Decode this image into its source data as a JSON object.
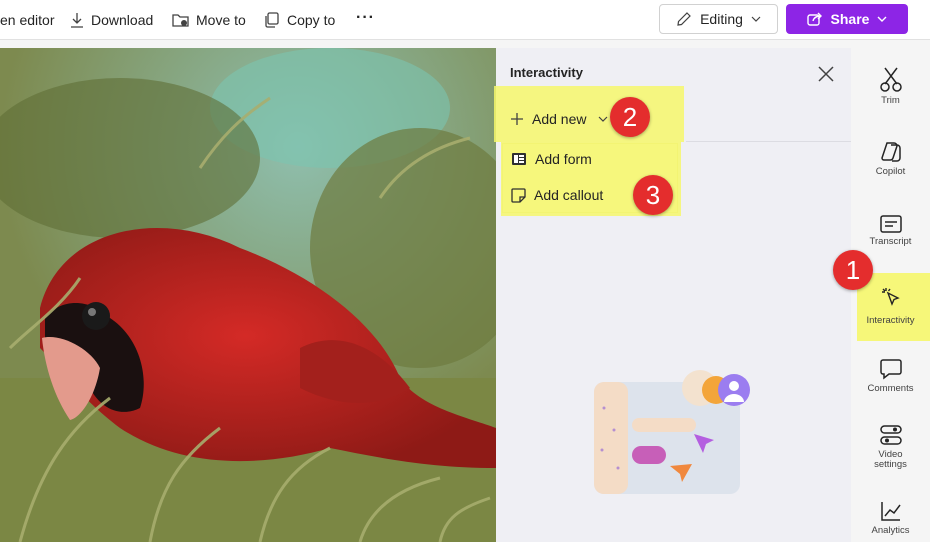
{
  "toolbar": {
    "open_editor_label": "en editor",
    "download_label": "Download",
    "move_to_label": "Move to",
    "copy_to_label": "Copy to",
    "more_label": "···",
    "editing_label": "Editing",
    "share_label": "Share"
  },
  "panel": {
    "title": "Interactivity",
    "add_new_label": "Add new",
    "menu": [
      {
        "label": "Add form",
        "icon": "form-icon"
      },
      {
        "label": "Add callout",
        "icon": "callout-icon"
      }
    ]
  },
  "annotations": [
    "1",
    "2",
    "3"
  ],
  "rail": {
    "items": [
      {
        "label": "Trim",
        "icon": "scissors-icon"
      },
      {
        "label": "Copilot",
        "icon": "copilot-icon"
      },
      {
        "label": "Transcript",
        "icon": "transcript-icon"
      },
      {
        "label": "Interactivity",
        "icon": "cursor-click-icon"
      },
      {
        "label": "Comments",
        "icon": "comment-icon"
      },
      {
        "label": "Video settings",
        "icon": "toggles-icon"
      },
      {
        "label": "Analytics",
        "icon": "chart-icon"
      }
    ]
  },
  "colors": {
    "share": "#8d25e6",
    "highlight": "#f6f76b",
    "badge": "#e42d2d"
  }
}
